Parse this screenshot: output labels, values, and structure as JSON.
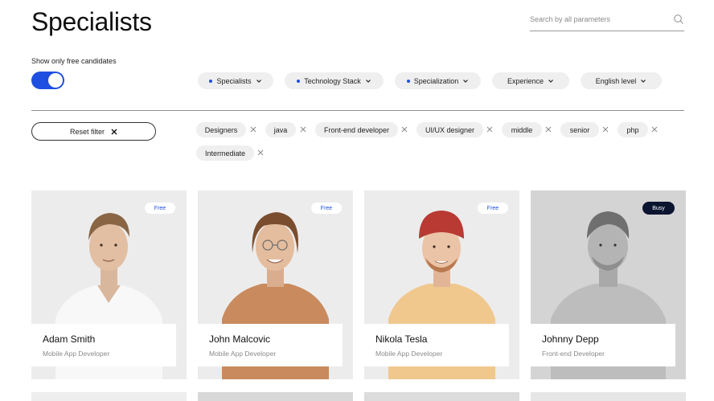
{
  "page": {
    "title": "Specialists"
  },
  "search": {
    "placeholder": "Search by all parameters"
  },
  "filters": {
    "free_only_label": "Show only free candidates",
    "free_only_enabled": true,
    "dropdowns": [
      {
        "label": "Specialists",
        "active": true
      },
      {
        "label": "Technology Stack",
        "active": true
      },
      {
        "label": "Specialization",
        "active": true
      },
      {
        "label": "Experience",
        "active": false
      },
      {
        "label": "English level",
        "active": false
      }
    ],
    "reset_label": "Reset filter",
    "tags": [
      "Designers",
      "java",
      "Front-end developer",
      "UI/UX designer",
      "middle",
      "senior",
      "php",
      "Intermediate"
    ]
  },
  "cards": [
    {
      "name": "Adam Smith",
      "role": "Mobile App Developer",
      "status": "Free"
    },
    {
      "name": "John Malcovic",
      "role": "Mobile App Developer",
      "status": "Free"
    },
    {
      "name": "Nikola Tesla",
      "role": "Mobile App Developer",
      "status": "Free"
    },
    {
      "name": "Johnny Depp",
      "role": "Front-end Developer",
      "status": "Busy"
    }
  ],
  "colors": {
    "accent": "#1f4fe0",
    "busy_badge": "#0b1530",
    "chip_bg": "#efefef",
    "card_bg": "#ececec"
  }
}
